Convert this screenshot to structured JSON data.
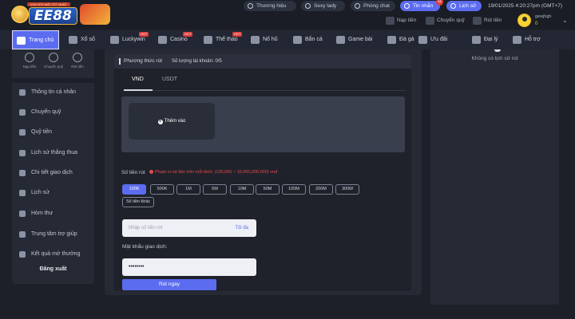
{
  "brand": {
    "logo_text": "EE88",
    "logo_ribbon": "KHUYẾN MÃI TỐT NHẤT"
  },
  "topbar": {
    "links": [
      "Thương hiệu",
      "Sexy lady",
      "Phòng chat"
    ],
    "messages": {
      "label": "Tin nhắn",
      "count": "11"
    },
    "history": "Lịch sử",
    "datetime": "19/01/2025 4:20:27pm (GMT+7)",
    "quick_actions": [
      "Nạp tiền",
      "Chuyển quỹ",
      "Rút tiền"
    ],
    "user": {
      "name": "gewjhgh",
      "balance": "0"
    }
  },
  "nav": {
    "items": [
      {
        "label": "Trang chủ",
        "active": true,
        "icon": "home-icon"
      },
      {
        "label": "Xổ số",
        "icon": "lottery-icon"
      },
      {
        "label": "Luckywin",
        "hot": true,
        "icon": "luckywin-icon"
      },
      {
        "label": "Casino",
        "hot": true,
        "icon": "casino-icon"
      },
      {
        "label": "Thể thao",
        "hot": true,
        "icon": "sports-icon"
      },
      {
        "label": "Nổ hũ",
        "icon": "slots-icon"
      },
      {
        "label": "Bắn cá",
        "icon": "fish-icon"
      },
      {
        "label": "Game bài",
        "icon": "cards-icon"
      },
      {
        "label": "Đá gà",
        "icon": "cockfight-icon"
      },
      {
        "label": "Ưu đãi",
        "icon": "gift-icon"
      },
      {
        "label": "Đại lý",
        "icon": "agent-icon"
      },
      {
        "label": "Hỗ trợ",
        "icon": "support-icon"
      }
    ],
    "hot_tag": "HOT"
  },
  "sidebar": {
    "quick": [
      "Nạp tiền",
      "Chuyển quỹ",
      "Rút tiền"
    ],
    "items": [
      {
        "label": "Thông tin cá nhân",
        "icon": "user-icon"
      },
      {
        "label": "Chuyển quỹ",
        "icon": "transfer-icon"
      },
      {
        "label": "Quỹ tiền",
        "icon": "wallet-icon"
      },
      {
        "label": "Lịch sử thắng thua",
        "icon": "history-icon"
      },
      {
        "label": "Chi tiết giao dịch",
        "icon": "transaction-icon"
      },
      {
        "label": "Lịch sử",
        "icon": "list-icon"
      },
      {
        "label": "Hòm thư",
        "icon": "mail-icon"
      },
      {
        "label": "Trung tâm trợ giúp",
        "icon": "help-icon"
      },
      {
        "label": "Kết quả mở thưởng",
        "icon": "trophy-icon"
      }
    ],
    "logout": "Đăng xuất"
  },
  "withdraw": {
    "header_title": "Phương thức rút",
    "header_count": "Số lượng tài khoản: 0/5",
    "tabs": [
      "VND",
      "USDT"
    ],
    "add_label": "Thêm vào",
    "amount_label": "Số tiền rút",
    "amount_note": "Phạm vi rút tiền trên mỗi lệnh: (100,000 ~ 10,000,000,000) vnđ",
    "chips": [
      "100K",
      "500K",
      "1M",
      "5M",
      "10M",
      "50M",
      "100M",
      "200M",
      "300M"
    ],
    "other_chip": "Số tiền khác",
    "amount_placeholder": "Nhập số tiền rút",
    "max_label": "Tối đa",
    "password_label": "Mật khẩu giao dịch:",
    "password_value": "••••••••",
    "submit_label": "Rút ngay"
  },
  "history_panel": {
    "empty": "Không có lịch sử rút"
  }
}
